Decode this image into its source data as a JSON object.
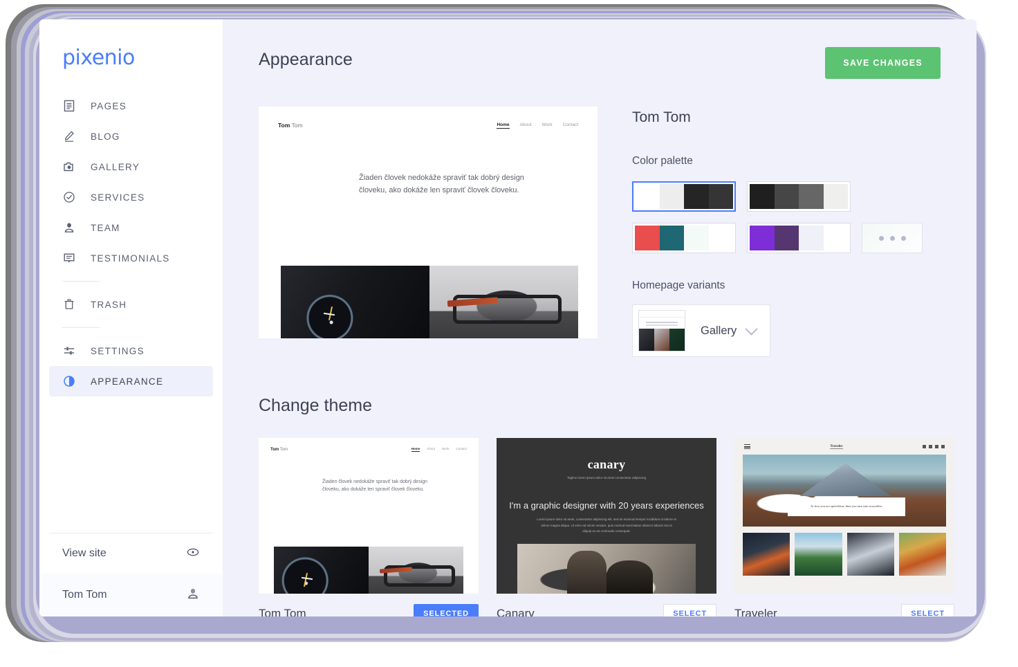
{
  "brand": {
    "logo": "pixenio"
  },
  "sidebar": {
    "items": [
      {
        "label": "PAGES",
        "icon": "pages-icon"
      },
      {
        "label": "BLOG",
        "icon": "pencil-icon"
      },
      {
        "label": "GALLERY",
        "icon": "camera-icon"
      },
      {
        "label": "SERVICES",
        "icon": "check-circle-icon"
      },
      {
        "label": "TEAM",
        "icon": "person-icon"
      },
      {
        "label": "TESTIMONIALS",
        "icon": "comment-icon"
      }
    ],
    "trash": {
      "label": "TRASH",
      "icon": "trash-icon"
    },
    "settings": {
      "label": "SETTINGS",
      "icon": "sliders-icon"
    },
    "appearance": {
      "label": "APPEARANCE",
      "icon": "contrast-circle-icon",
      "active": true
    },
    "view_site": {
      "label": "View site",
      "icon": "eye-icon"
    },
    "user": {
      "label": "Tom Tom",
      "icon": "account-icon"
    }
  },
  "header": {
    "title": "Appearance",
    "save_label": "SAVE CHANGES",
    "save_color": "#5cc372"
  },
  "preview": {
    "brand_bold": "Tom",
    "brand_rest": " Tom",
    "nav": [
      "Home",
      "About",
      "Work",
      "Contact"
    ],
    "quote": "Žiaden človek nedokáže spraviť tak dobrý design človeku, ako dokáže len spraviť človek človeku.",
    "images": [
      "watch-photo",
      "glasses-photo"
    ]
  },
  "settings_panel": {
    "site_name": "Tom Tom",
    "color_palette_label": "Color palette",
    "palettes": [
      {
        "selected": true,
        "swatches": [
          "#ffffff",
          "#ededed",
          "#252525",
          "#353535"
        ]
      },
      {
        "selected": false,
        "swatches": [
          "#1f1f1f",
          "#464646",
          "#666666",
          "#efefed"
        ]
      },
      {
        "selected": false,
        "swatches": [
          "#ea4d4d",
          "#1f6773",
          "#f4faf8",
          "#ffffff"
        ]
      },
      {
        "selected": false,
        "swatches": [
          "#7d2ed6",
          "#553671",
          "#f0f0f8",
          "#ffffff"
        ]
      }
    ],
    "more_palettes_icon": "ellipsis-icon",
    "homepage_variants_label": "Homepage variants",
    "variant_selected": "Gallery",
    "variant_chevron": "chevron-down-icon"
  },
  "themes_section": {
    "title": "Change theme",
    "themes": [
      {
        "name": "Tom Tom",
        "button": "SELECTED",
        "state": "selected",
        "preview": {
          "brand_bold": "Tom",
          "brand_rest": " Tom",
          "nav": [
            "Home",
            "About",
            "Work",
            "Contact"
          ],
          "quote": "Žiaden človek nedokáže spraviť tak dobrý design človeku, ako dokáže len spraviť človek človeku."
        }
      },
      {
        "name": "Canary",
        "button": "SELECT",
        "state": "available",
        "preview": {
          "title": "canary",
          "tagline": "Tagline lorem ipsum dolor sit amet consectetur adipiscing",
          "heading": "I'm a graphic designer with 20 years experiences",
          "paragraph": "Lorem ipsum dolor sit amet, consectetur adipiscing elit, sed do eiusmod tempor incididunt ut labore et dolore magna aliqua. Ut enim ad minim veniam, quis nostrud exercitation ullamco laboris nisi ut aliquip ex ea commodo consequat."
        }
      },
      {
        "name": "Traveler",
        "button": "SELECT",
        "state": "available",
        "preview": {
          "brand": "Traveler",
          "quote": "At first you are speechless, then you turn into storyteller.",
          "menu_icon": "hamburger-icon",
          "search_icon": "search-icon"
        }
      }
    ]
  },
  "colors": {
    "accent_blue": "#4a7dfc",
    "green": "#5cc372",
    "app_bg": "#f0f1fb",
    "sidebar_bg": "#ffffff"
  }
}
